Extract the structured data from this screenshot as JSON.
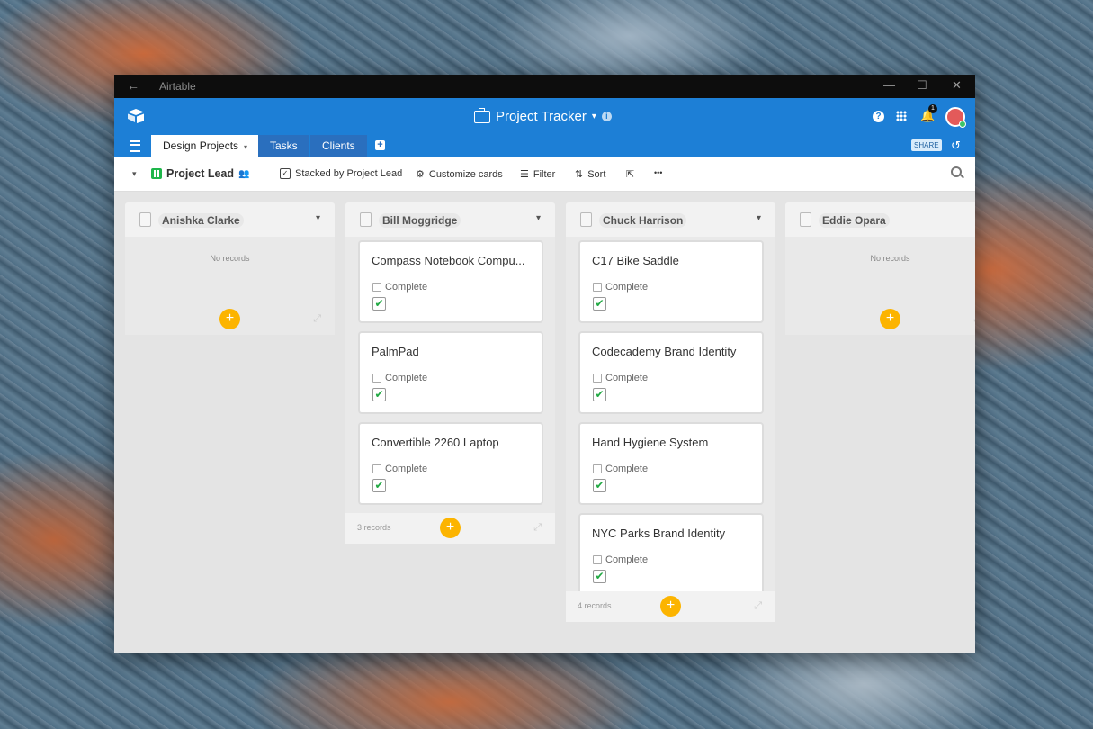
{
  "titlebar": {
    "back": "←",
    "app_title": "Airtable",
    "minimize": "—",
    "maximize": "☐",
    "close": "✕"
  },
  "header": {
    "base_title": "Project Tracker",
    "base_caret": "▾",
    "info": "i",
    "help": "?",
    "bell": "🔔",
    "notifications": "1",
    "share_label": "SHARE",
    "history": "↺"
  },
  "tabs": [
    {
      "label": "Design Projects",
      "caret": "▾"
    },
    {
      "label": "Tasks"
    },
    {
      "label": "Clients"
    }
  ],
  "add_tab": "+",
  "toolbar": {
    "view_caret": "▾",
    "view_name": "Project Lead",
    "people_icon": "👥",
    "stacked": "Stacked by Project Lead",
    "customize": "Customize cards",
    "filter": "Filter",
    "sort": "Sort",
    "share_view": "⇱",
    "more": "•••"
  },
  "stacks": [
    {
      "name": "Anishka Clarke",
      "empty": "No records",
      "caret": "▾",
      "add": "+",
      "expand": "⤢"
    },
    {
      "name": "Bill Moggridge",
      "caret": "▾",
      "count": "3 records",
      "add": "+",
      "expand": "⤢",
      "cards": [
        {
          "name": "Compass Notebook Compu...",
          "field": "Complete",
          "check": "✔"
        },
        {
          "name": "PalmPad",
          "field": "Complete",
          "check": "✔"
        },
        {
          "name": "Convertible 2260 Laptop",
          "field": "Complete",
          "check": "✔"
        }
      ]
    },
    {
      "name": "Chuck Harrison",
      "caret": "▾",
      "count": "4 records",
      "add": "+",
      "expand": "⤢",
      "cards": [
        {
          "name": "C17 Bike Saddle",
          "field": "Complete",
          "check": "✔"
        },
        {
          "name": "Codecademy Brand Identity",
          "field": "Complete",
          "check": "✔"
        },
        {
          "name": "Hand Hygiene System",
          "field": "Complete",
          "check": "✔"
        },
        {
          "name": "NYC Parks Brand Identity",
          "field": "Complete",
          "check": "✔"
        }
      ]
    },
    {
      "name": "Eddie Opara",
      "empty": "No records",
      "add": "+",
      "expand": "⤢"
    }
  ],
  "colors": {
    "header_blue": "#1d7fd6",
    "add_yellow": "#fcb400",
    "check_green": "#21a943",
    "kanban_green": "#1eb64a"
  }
}
